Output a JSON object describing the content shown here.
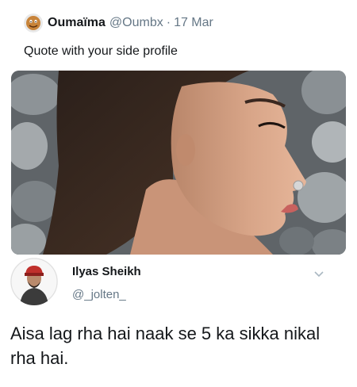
{
  "quoted_tweet": {
    "author_name": "Oumaïma",
    "author_handle": "@Oumbx",
    "separator": "·",
    "date": "17 Mar",
    "text": "Quote with your side profile",
    "avatar_icon": "emoji-avatar-icon",
    "image_description_icon": "side-profile-photo"
  },
  "reply_tweet": {
    "author_name": "Ilyas Sheikh",
    "author_handle": "@_jolten_",
    "text": "Aisa lag rha hai naak se 5 ka sikka nikal rha hai.",
    "menu_icon": "chevron-down-icon"
  },
  "colors": {
    "text_primary": "#14171a",
    "text_secondary": "#657786",
    "background": "#ffffff"
  }
}
